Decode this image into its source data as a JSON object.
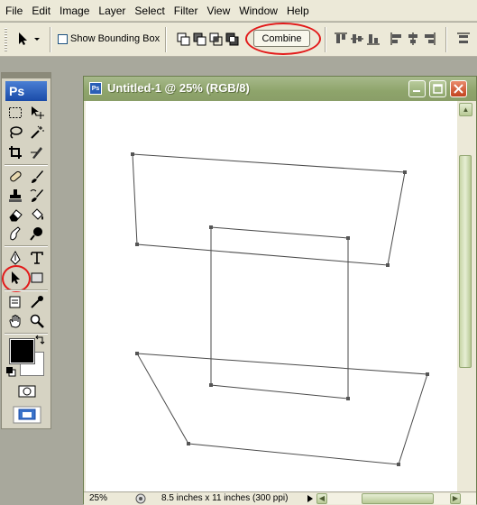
{
  "menu": [
    "File",
    "Edit",
    "Image",
    "Layer",
    "Select",
    "Filter",
    "View",
    "Window",
    "Help"
  ],
  "options_bar": {
    "show_bounding_box_label": "Show Bounding Box",
    "show_bounding_box_checked": false,
    "combine_label": "Combine"
  },
  "toolbox": {
    "logo": "Ps"
  },
  "document": {
    "title": "Untitled-1 @ 25% (RGB/8)",
    "icon_text": "Ps",
    "zoom": "25%",
    "doc_size": "8.5 inches x 11 inches (300 ppi)"
  },
  "colors": {
    "highlight_ring": "#e21a1a",
    "title_bar": "#8ea46b"
  }
}
